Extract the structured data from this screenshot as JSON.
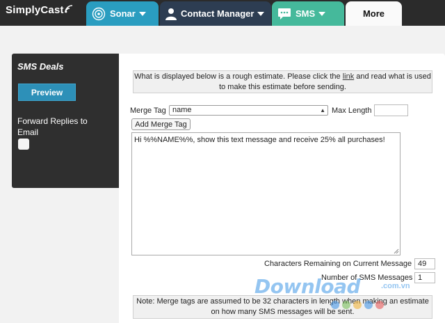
{
  "brand": {
    "logo_text": "SimplyCast"
  },
  "nav": {
    "tabs": [
      {
        "label": "Sonar",
        "icon": "sonar-icon",
        "color": "#2a9dc0"
      },
      {
        "label": "Contact Manager",
        "icon": "person-icon",
        "color": "#2d3d52"
      },
      {
        "label": "SMS",
        "icon": "chat-bubble-icon",
        "color": "#45b99b"
      },
      {
        "label": "More",
        "color": "#fafafa"
      }
    ]
  },
  "sidebar": {
    "title": "SMS Deals",
    "preview_label": "Preview",
    "forward_replies_label": "Forward Replies to Email"
  },
  "main": {
    "info_before_link": "What is displayed below is a rough estimate. Please click the ",
    "info_link": "link",
    "info_after_link": " and read what is used to make this estimate before sending.",
    "merge_tag_label": "Merge Tag",
    "merge_tag_selected": "name",
    "max_length_label": "Max Length",
    "max_length_value": "",
    "add_merge_tag_label": "Add Merge Tag",
    "message_text": "Hi %%NAME%%, show this text message and receive 25% all purchases!",
    "chars_remaining_label": "Characters Remaining on Current Message",
    "chars_remaining_value": "49",
    "num_messages_label": "Number of SMS Messages",
    "num_messages_value": "1",
    "note_text": "Note: Merge tags are assumed to be 32 characters in length when making an estimate on how many SMS messages will be sent."
  },
  "watermark": {
    "text": "Download",
    "suffix": ".com.vn"
  }
}
